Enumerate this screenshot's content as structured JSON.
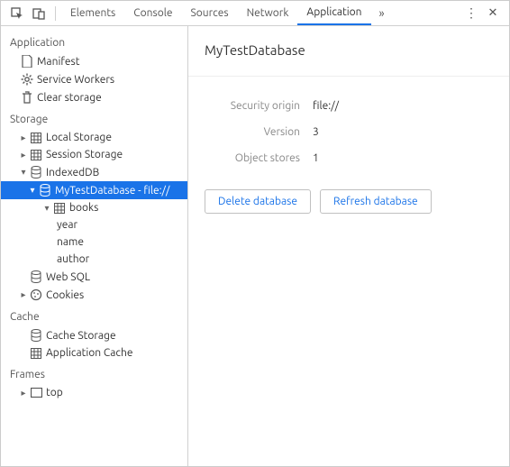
{
  "toolbar": {
    "tabs": [
      "Elements",
      "Console",
      "Sources",
      "Network",
      "Application"
    ],
    "activeIndex": 4
  },
  "sidebar": {
    "sections": {
      "application": {
        "title": "Application",
        "items": {
          "manifest": "Manifest",
          "serviceWorkers": "Service Workers",
          "clearStorage": "Clear storage"
        }
      },
      "storage": {
        "title": "Storage",
        "items": {
          "localStorage": "Local Storage",
          "sessionStorage": "Session Storage",
          "indexedDB": "IndexedDB",
          "database": "MyTestDatabase - file://",
          "store": "books",
          "fields": {
            "year": "year",
            "name": "name",
            "author": "author"
          },
          "webSQL": "Web SQL",
          "cookies": "Cookies"
        }
      },
      "cache": {
        "title": "Cache",
        "items": {
          "cacheStorage": "Cache Storage",
          "applicationCache": "Application Cache"
        }
      },
      "frames": {
        "title": "Frames",
        "items": {
          "top": "top"
        }
      }
    }
  },
  "detail": {
    "title": "MyTestDatabase",
    "props": {
      "securityOriginLabel": "Security origin",
      "securityOriginValue": "file://",
      "versionLabel": "Version",
      "versionValue": "3",
      "objectStoresLabel": "Object stores",
      "objectStoresValue": "1"
    },
    "buttons": {
      "delete": "Delete database",
      "refresh": "Refresh database"
    }
  }
}
